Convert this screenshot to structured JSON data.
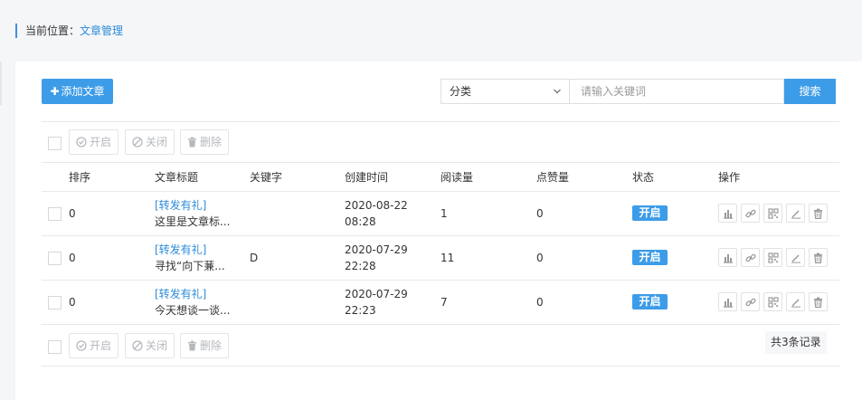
{
  "breadcrumb": {
    "prefix": "当前位置：",
    "current": "文章管理"
  },
  "toolbar": {
    "add_label": "添加文章",
    "category_value": "分类",
    "search_placeholder": "请输入关键词",
    "search_label": "搜索"
  },
  "bulk": {
    "enable": "开启",
    "disable": "关闭",
    "delete": "删除"
  },
  "columns": {
    "order": "排序",
    "title": "文章标题",
    "keyword": "关键字",
    "created": "创建时间",
    "reads": "阅读量",
    "likes": "点赞量",
    "status": "状态",
    "actions": "操作"
  },
  "rows": [
    {
      "order": "0",
      "tag": "[转发有礼]",
      "title": "这里是文章标...",
      "keyword": "",
      "date": "2020-08-22",
      "time": "08:28",
      "reads": "1",
      "likes": "0",
      "status": "开启"
    },
    {
      "order": "0",
      "tag": "[转发有礼]",
      "title": "寻找“向下蒹...",
      "keyword": "D",
      "date": "2020-07-29",
      "time": "22:28",
      "reads": "11",
      "likes": "0",
      "status": "开启"
    },
    {
      "order": "0",
      "tag": "[转发有礼]",
      "title": "今天想谈一谈...",
      "keyword": "",
      "date": "2020-07-29",
      "time": "22:23",
      "reads": "7",
      "likes": "0",
      "status": "开启"
    }
  ],
  "icons": {
    "row_actions": [
      "bar-chart-icon",
      "link-icon",
      "qrcode-icon",
      "edit-icon",
      "trash-icon"
    ],
    "bulk": [
      "check-circle-icon",
      "ban-icon",
      "trash-icon"
    ]
  },
  "colors": {
    "accent": "#3d9ce8",
    "link": "#2d8bd9",
    "border": "#dfe2e6"
  },
  "footer": {
    "total": "共3条记录"
  }
}
